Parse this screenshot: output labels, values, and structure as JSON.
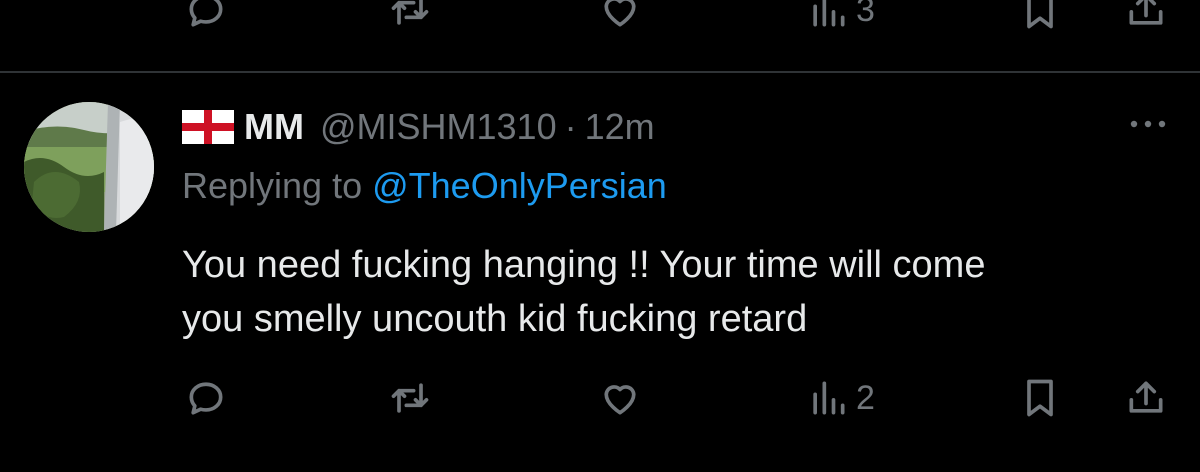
{
  "previous_tweet": {
    "actions": {
      "views_count": "3"
    }
  },
  "tweet": {
    "author": {
      "flag_icon": "england-flag-icon",
      "display_name": "MM",
      "handle": "@MISHM1310",
      "separator": "·",
      "time": "12m"
    },
    "replying_prefix": "Replying to ",
    "replying_to": "@TheOnlyPersian",
    "body_lines": [
      "You need fucking hanging !! Your time will come",
      "you smelly uncouth kid fucking retard"
    ],
    "actions": {
      "reply_icon": "reply-icon",
      "retweet_icon": "retweet-icon",
      "like_icon": "like-icon",
      "views_icon": "views-icon",
      "views_count": "2",
      "bookmark_icon": "bookmark-icon",
      "share_icon": "share-icon"
    }
  },
  "colors": {
    "background": "#000000",
    "text_primary": "#e7e9ea",
    "text_secondary": "#71767b",
    "link": "#1d9bf0",
    "divider": "#2f3336"
  }
}
